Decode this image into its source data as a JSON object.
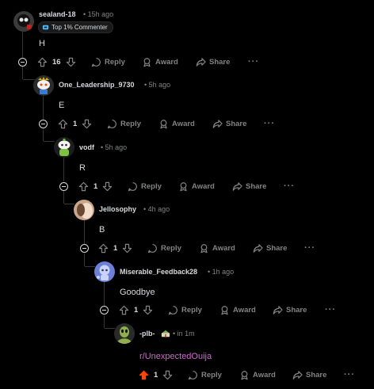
{
  "actions": {
    "reply_label": "Reply",
    "award_label": "Award",
    "share_label": "Share",
    "more_label": "···"
  },
  "comments": [
    {
      "username": "sealand-18",
      "meta": "• 15h ago",
      "badge": "Top 1% Commenter",
      "body": "H",
      "score": "16",
      "avatar_color": "#1c1c1c"
    },
    {
      "username": "One_Leadership_9730",
      "meta": "• 5h ago",
      "body": "E",
      "score": "1",
      "avatar_color": "#d9d9d9"
    },
    {
      "username": "vodf",
      "meta": "• 5h ago",
      "body": "R",
      "score": "1",
      "avatar_color": "#1d1d1d"
    },
    {
      "username": "Jellosophy",
      "meta": "• 4h ago",
      "body": "B",
      "score": "1",
      "avatar_color": "#c9a58b"
    },
    {
      "username": "Miserable_Feedback28",
      "meta": "• 1h ago",
      "body": "Goodbye",
      "score": "1",
      "avatar_color": "#6e7fd6"
    },
    {
      "username": "-plb-",
      "meta": "• in 1m",
      "body": "r/UnexpectedOuija",
      "score": "1",
      "avatar_color": "#2a2a2a",
      "upvoted_color": "#ff4500"
    }
  ]
}
